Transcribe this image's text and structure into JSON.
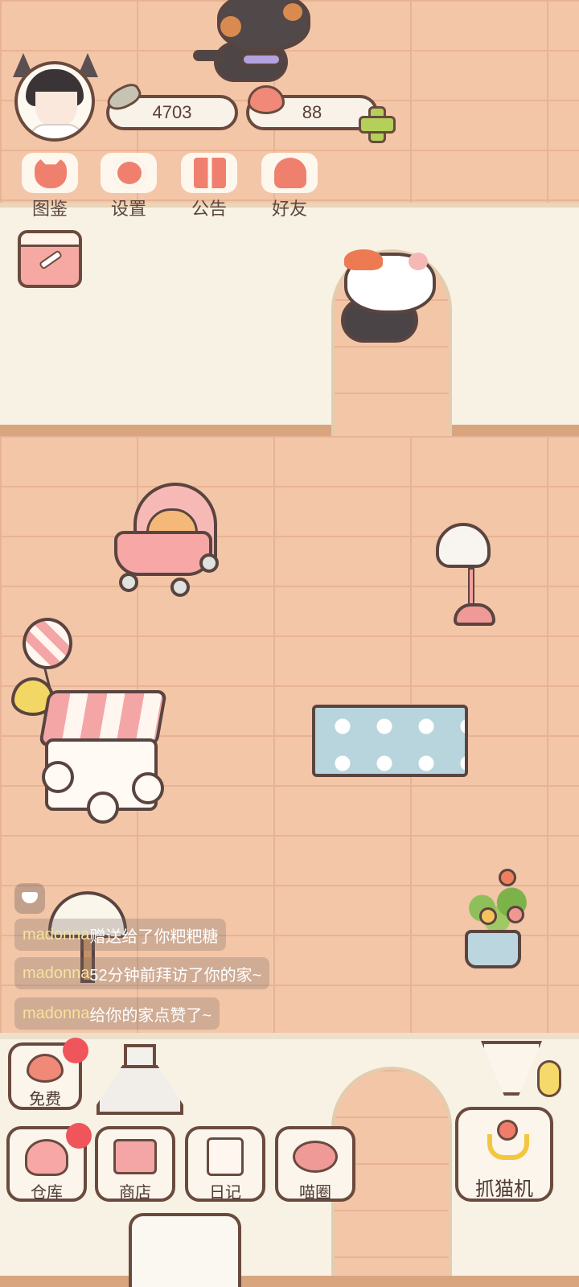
{
  "currency": {
    "fish_count": "4703",
    "heart_count": "88"
  },
  "top_menu": [
    {
      "label": "图鉴",
      "icon": "cat-head-icon"
    },
    {
      "label": "设置",
      "icon": "gear-icon"
    },
    {
      "label": "公告",
      "icon": "gift-icon"
    },
    {
      "label": "好友",
      "icon": "friends-icon"
    }
  ],
  "chat_feed": [
    {
      "user": "madonna",
      "text": "赠送给了你粑粑糖"
    },
    {
      "user": "madonna",
      "text": "52分钟前拜访了你的家~"
    },
    {
      "user": "madonna",
      "text": "给你的家点赞了~"
    }
  ],
  "bottom_buttons": {
    "free": "免费",
    "storage": "仓库",
    "shop": "商店",
    "diary": "日记",
    "cat_circle": "喵圈",
    "claw_machine": "抓猫机"
  },
  "colors": {
    "brick_wall": "#f3c6a8",
    "room_wall": "#f8f2e4",
    "outline": "#6b4a3e",
    "accent_pink": "#f0806e",
    "notification_red": "#f0555c",
    "chat_username": "#f6e39a"
  }
}
